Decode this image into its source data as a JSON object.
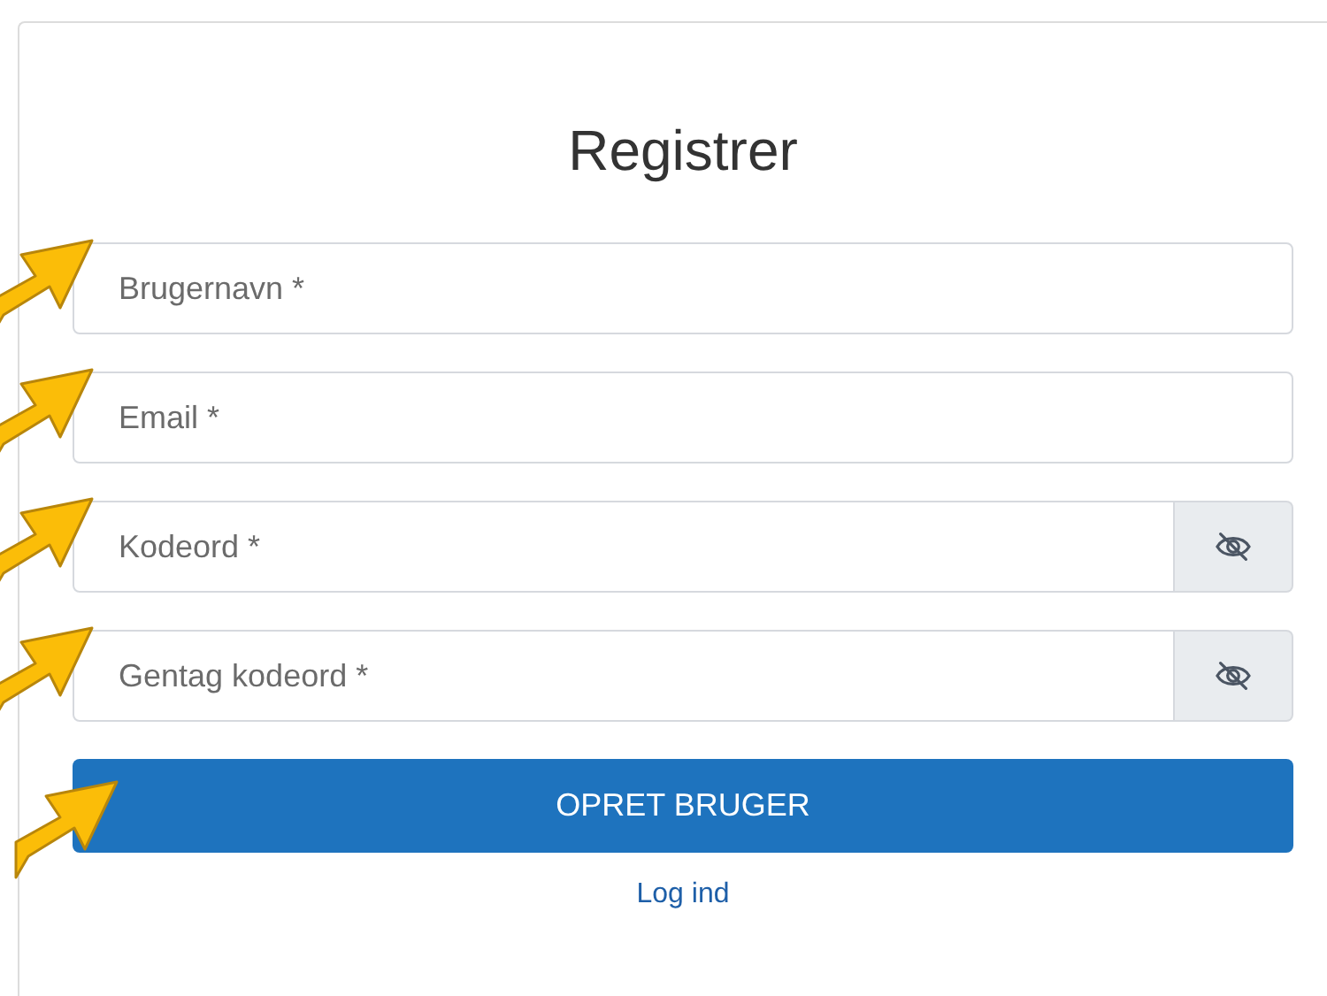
{
  "title": "Registrer",
  "fields": [
    {
      "kind": "text",
      "placeholder": "Brugernavn *"
    },
    {
      "kind": "text",
      "placeholder": "Email *"
    },
    {
      "kind": "password",
      "placeholder": "Kodeord *"
    },
    {
      "kind": "password",
      "placeholder": "Gentag kodeord *"
    }
  ],
  "submit": "OPRET BRUGER",
  "login_link": "Log ind"
}
